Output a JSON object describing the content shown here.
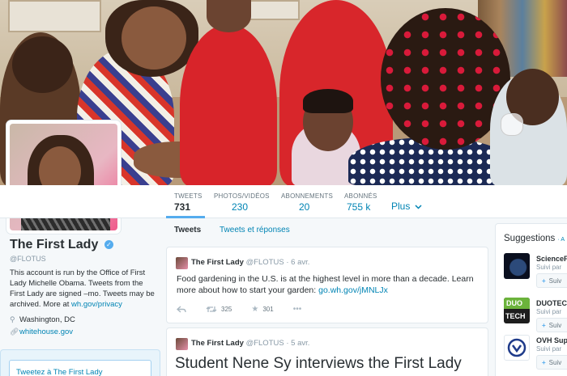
{
  "profile": {
    "name": "The First Lady",
    "handle": "@FLOTUS",
    "bio_text": "This account is run by the Office of First Lady Michelle Obama. Tweets from the First Lady are signed –mo. Tweets may be archived. More at ",
    "bio_link": "wh.gov/privacy",
    "location": "Washington, DC",
    "website": "whitehouse.gov",
    "tweet_to": "Tweetez à The First Lady",
    "verified_mark": "✓"
  },
  "nav": {
    "tweets": {
      "label": "TWEETS",
      "value": "731"
    },
    "photos": {
      "label": "PHOTOS/VIDÉOS",
      "value": "230"
    },
    "following": {
      "label": "ABONNEMENTS",
      "value": "20"
    },
    "followers": {
      "label": "ABONNÉS",
      "value": "755 k"
    },
    "more": "Plus"
  },
  "tabs": {
    "tweets": "Tweets",
    "replies": "Tweets et réponses"
  },
  "tweets": [
    {
      "name": "The First Lady",
      "handle": "@FLOTUS",
      "date": "· 6 avr.",
      "text": "Food gardening in the U.S. is at the highest level in more than a decade. Learn more about how to start your garden: ",
      "link": "go.wh.gov/jMNLJx",
      "retweets": "325",
      "favorites": "301"
    },
    {
      "name": "The First Lady",
      "handle": "@FLOTUS",
      "date": "· 5 avr.",
      "headline": "Student Nene Sy interviews the First Lady"
    }
  ],
  "suggestions": {
    "title": "Suggestions",
    "title_suffix": "· A",
    "items": [
      {
        "name": "ScienceF",
        "sub": "Suivi par",
        "button": "Suiv"
      },
      {
        "name": "DUOTEC",
        "sub": "Suivi par",
        "button": "Suiv"
      },
      {
        "name": "OVH Sup",
        "sub": "Suivi par",
        "button": "Suiv"
      }
    ],
    "logo_duo": "DUO",
    "logo_tech": "TECH"
  },
  "colors": {
    "accent": "#55acee",
    "link": "#0084b4"
  }
}
